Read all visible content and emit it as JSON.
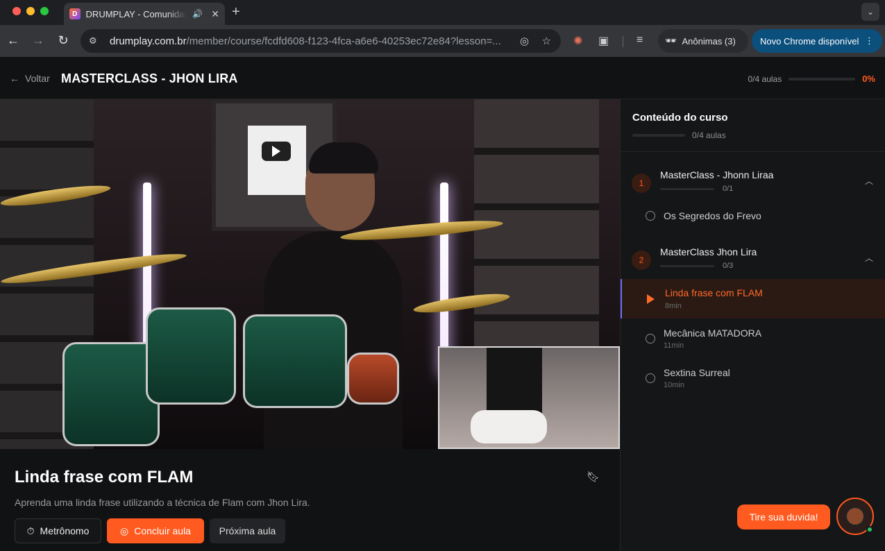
{
  "browser": {
    "tab_title": "DRUMPLAY - Comunidade",
    "favicon_letter": "D",
    "url_host": "drumplay.com.br",
    "url_path": "/member/course/fcdfd608-f123-4fca-a6e6-40253ec72e84?lesson=...",
    "incognito_label": "Anônimas (3)",
    "update_label": "Novo Chrome disponível"
  },
  "header": {
    "back_label": "Voltar",
    "course_title": "MASTERCLASS - JHON LIRA",
    "progress_text": "0/4 aulas",
    "progress_percent": "0%",
    "progress_value": 0
  },
  "lesson": {
    "title": "Linda frase com FLAM",
    "description": "Aprenda uma linda frase utilizando a técnica de Flam com Jhon Lira.",
    "metronome_label": "Metrônomo",
    "complete_label": "Concluir aula",
    "next_label": "Próxima aula"
  },
  "sidebar": {
    "title": "Conteúdo do curso",
    "progress_text": "0/4 aulas",
    "modules": [
      {
        "number": "1",
        "title": "MasterClass - Jhonn Liraa",
        "progress_text": "0/1",
        "lessons": [
          {
            "name": "Os Segredos do Frevo",
            "duration": ""
          }
        ]
      },
      {
        "number": "2",
        "title": "MasterClass Jhon Lira",
        "progress_text": "0/3",
        "lessons": [
          {
            "name": "Linda frase com FLAM",
            "duration": "8min",
            "active": true
          },
          {
            "name": "Mecânica MATADORA",
            "duration": "11min"
          },
          {
            "name": "Sextina Surreal",
            "duration": "10min"
          }
        ]
      }
    ]
  },
  "chat": {
    "label": "Tire sua duvida!"
  },
  "colors": {
    "accent": "#ff5a1f",
    "background": "#111214",
    "sidebar": "#151618"
  }
}
